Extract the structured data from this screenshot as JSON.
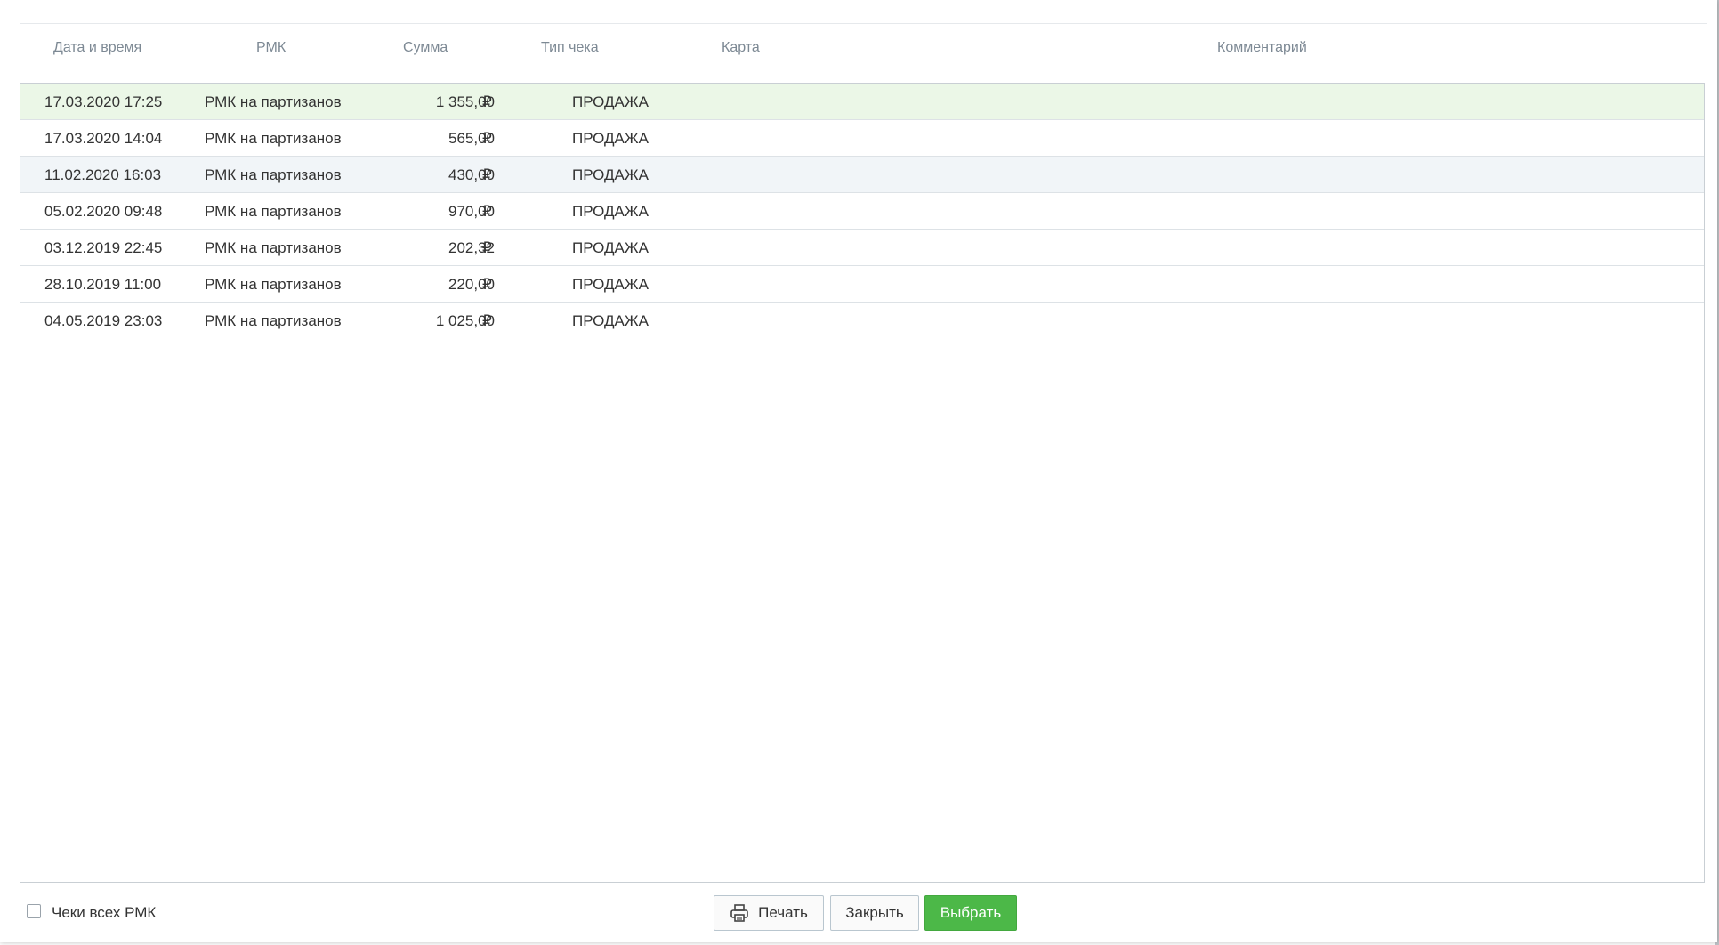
{
  "table": {
    "columns": [
      "Дата и время",
      "РМК",
      "Сумма",
      "Тип чека",
      "Карта",
      "Комментарий"
    ],
    "currency_symbol": "₽",
    "rows": [
      {
        "datetime": "17.03.2020 17:25",
        "rmk": "РМК на партизанов",
        "sum": "1 355,00",
        "type": "ПРОДАЖА"
      },
      {
        "datetime": "17.03.2020 14:04",
        "rmk": "РМК на партизанов",
        "sum": "565,00",
        "type": "ПРОДАЖА"
      },
      {
        "datetime": "11.02.2020 16:03",
        "rmk": "РМК на партизанов",
        "sum": "430,00",
        "type": "ПРОДАЖА"
      },
      {
        "datetime": "05.02.2020 09:48",
        "rmk": "РМК на партизанов",
        "sum": "970,00",
        "type": "ПРОДАЖА"
      },
      {
        "datetime": "03.12.2019 22:45",
        "rmk": "РМК на партизанов",
        "sum": "202,32",
        "type": "ПРОДАЖА"
      },
      {
        "datetime": "28.10.2019 11:00",
        "rmk": "РМК на партизанов",
        "sum": "220,00",
        "type": "ПРОДАЖА"
      },
      {
        "datetime": "04.05.2019 23:03",
        "rmk": "РМК на партизанов",
        "sum": "1 025,00",
        "type": "ПРОДАЖА"
      }
    ]
  },
  "footer": {
    "all_rmk_checkbox_label": "Чеки всех РМК",
    "all_rmk_checked": false,
    "print_label": "Печать",
    "close_label": "Закрыть",
    "select_label": "Выбрать"
  },
  "colors": {
    "selected_row": "#ebf7e7",
    "primary_button": "#4cb848"
  },
  "icons": {
    "print": "printer-icon"
  }
}
